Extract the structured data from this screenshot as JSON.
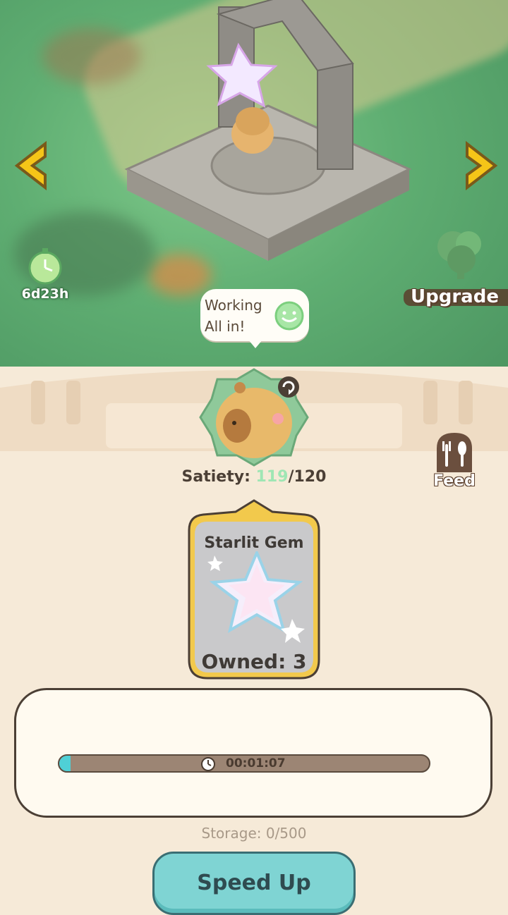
{
  "scene": {
    "timer_label": "6d23h",
    "upgrade_label": "Upgrade",
    "bubble_text": "Working\nAll in!"
  },
  "worker": {
    "satiety_prefix": "Satiety: ",
    "satiety_current": "119",
    "satiety_max": "/120",
    "feed_label": "Feed"
  },
  "product": {
    "name": "Starlit Gem",
    "owned_label": "Owned: 3"
  },
  "production": {
    "progress": 0.03,
    "time_remaining": "00:01:07",
    "storage_label": "Storage: 0/500"
  },
  "actions": {
    "speed_up_label": "Speed Up"
  },
  "colors": {
    "accent": "#7fd4d3",
    "arrow": "#f5c518",
    "satiety_value": "#9fe6b4"
  }
}
